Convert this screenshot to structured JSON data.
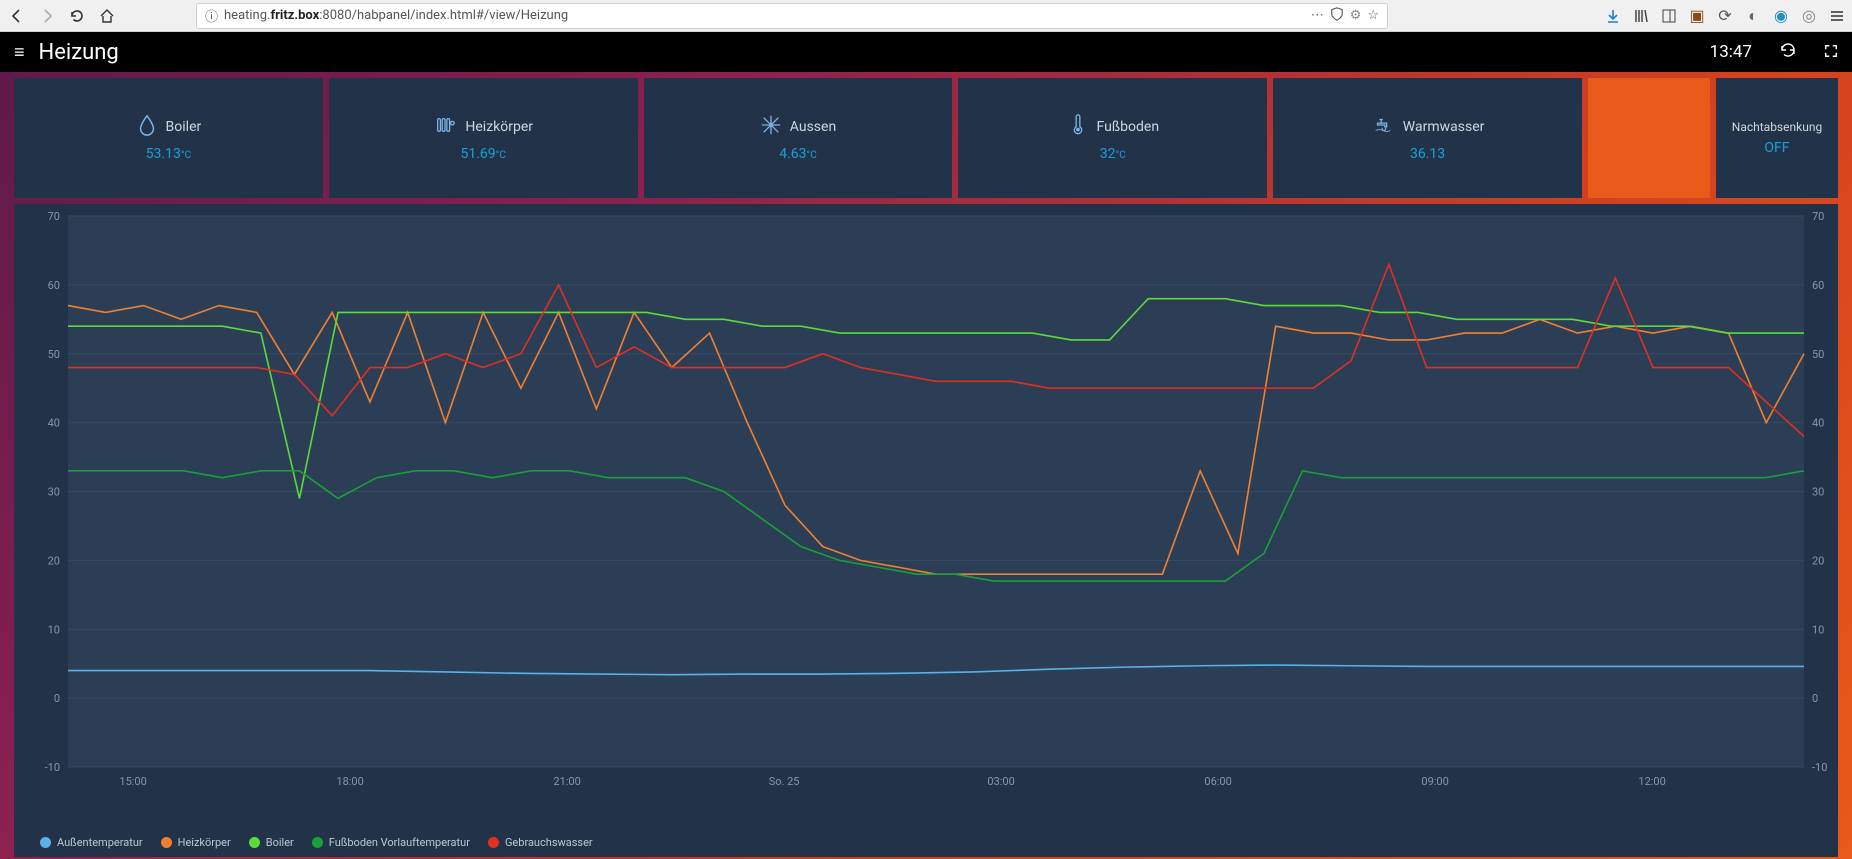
{
  "browser": {
    "url_prefix": "heating.",
    "url_bold": "fritz.box",
    "url_suffix": ":8080/habpanel/index.html#/view/Heizung"
  },
  "header": {
    "title": "Heizung",
    "time": "13:47"
  },
  "tiles": [
    {
      "label": "Boiler",
      "value": "53.13",
      "unit": "°C",
      "icon": "drop"
    },
    {
      "label": "Heizkörper",
      "value": "51.69",
      "unit": "°C",
      "icon": "radiator"
    },
    {
      "label": "Aussen",
      "value": "4.63",
      "unit": "°C",
      "icon": "snowflake"
    },
    {
      "label": "Fußboden",
      "value": "32",
      "unit": "°C",
      "icon": "thermo"
    },
    {
      "label": "Warmwasser",
      "value": "36.13",
      "unit": "",
      "icon": "faucet"
    }
  ],
  "night_tile": {
    "label": "Nachtabsenkung",
    "value": "OFF"
  },
  "chart_data": {
    "type": "line",
    "xlabel": "",
    "ylabel": "",
    "ylim": [
      -10,
      70
    ],
    "x_categories": [
      "15:00",
      "18:00",
      "21:00",
      "So. 25",
      "03:00",
      "06:00",
      "09:00",
      "12:00"
    ],
    "y_ticks": [
      -10,
      0,
      10,
      20,
      30,
      40,
      50,
      60,
      70
    ],
    "series": [
      {
        "name": "Außentemperatur",
        "color": "#5ab0e8",
        "values": [
          4,
          4,
          4,
          4,
          4,
          3.8,
          3.6,
          3.5,
          3.4,
          3.5,
          3.5,
          3.6,
          3.8,
          4.2,
          4.5,
          4.7,
          4.8,
          4.7,
          4.6,
          4.6,
          4.6,
          4.6,
          4.6,
          4.6
        ]
      },
      {
        "name": "Heizkörper",
        "color": "#f08030",
        "values": [
          57,
          56,
          57,
          55,
          57,
          56,
          47,
          56,
          43,
          56,
          40,
          56,
          45,
          56,
          42,
          56,
          48,
          53,
          40,
          28,
          22,
          20,
          19,
          18,
          18,
          18,
          18,
          18,
          18,
          18,
          33,
          21,
          54,
          53,
          53,
          52,
          52,
          53,
          53,
          55,
          53,
          54,
          53,
          54,
          53,
          40,
          50
        ]
      },
      {
        "name": "Boiler",
        "color": "#5adb3a",
        "values": [
          54,
          54,
          54,
          54,
          54,
          53,
          29,
          56,
          56,
          56,
          56,
          56,
          56,
          56,
          56,
          56,
          55,
          55,
          54,
          54,
          53,
          53,
          53,
          53,
          53,
          53,
          52,
          52,
          58,
          58,
          58,
          57,
          57,
          57,
          56,
          56,
          55,
          55,
          55,
          55,
          54,
          54,
          54,
          53,
          53,
          53
        ]
      },
      {
        "name": "Fußboden Vorlauftemperatur",
        "color": "#1aa038",
        "values": [
          33,
          33,
          33,
          33,
          32,
          33,
          33,
          29,
          32,
          33,
          33,
          32,
          33,
          33,
          32,
          32,
          32,
          30,
          26,
          22,
          20,
          19,
          18,
          18,
          17,
          17,
          17,
          17,
          17,
          17,
          17,
          21,
          33,
          32,
          32,
          32,
          32,
          32,
          32,
          32,
          32,
          32,
          32,
          32,
          32,
          33
        ]
      },
      {
        "name": "Gebrauchswasser",
        "color": "#e03020",
        "values": [
          48,
          48,
          48,
          48,
          48,
          48,
          47,
          41,
          48,
          48,
          50,
          48,
          50,
          60,
          48,
          51,
          48,
          48,
          48,
          48,
          50,
          48,
          47,
          46,
          46,
          46,
          45,
          45,
          45,
          45,
          45,
          45,
          45,
          45,
          49,
          63,
          48,
          48,
          48,
          48,
          48,
          61,
          48,
          48,
          48,
          43,
          38
        ]
      }
    ]
  },
  "legend": [
    {
      "label": "Außentemperatur",
      "color": "#5ab0e8"
    },
    {
      "label": "Heizkörper",
      "color": "#f08030"
    },
    {
      "label": "Boiler",
      "color": "#5adb3a"
    },
    {
      "label": "Fußboden Vorlauftemperatur",
      "color": "#1aa038"
    },
    {
      "label": "Gebrauchswasser",
      "color": "#e03020"
    }
  ]
}
